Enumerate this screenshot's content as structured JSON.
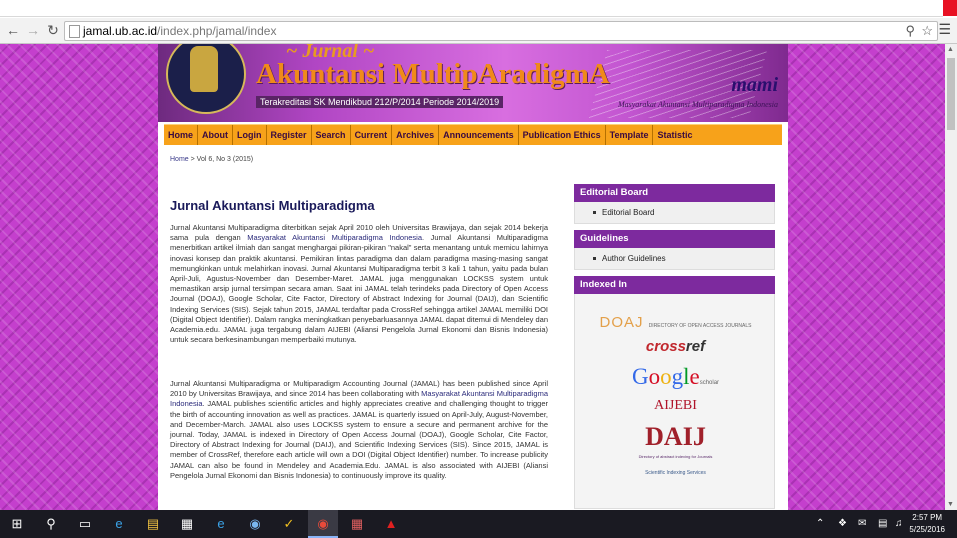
{
  "browser": {
    "back_icon": "arrow-left-icon",
    "forward_icon": "arrow-right-icon",
    "reload_icon": "reload-icon",
    "url_host": "jamal.ub.ac.id",
    "url_path": "/index.php/jamal/index"
  },
  "header": {
    "jurnal": "~ Jurnal ~",
    "title": "Akuntansi MultipAradigmA",
    "accreditation": "Terakreditasi SK Mendikbud 212/P/2014 Periode 2014/2019",
    "mami": "mami",
    "mami_sub": "Masyarakat Akuntansi Multiparadigma Indonesia"
  },
  "nav": {
    "items": [
      "Home",
      "About",
      "Login",
      "Register",
      "Search",
      "Current",
      "Archives",
      "Announcements",
      "Publication Ethics",
      "Template",
      "Statistic"
    ]
  },
  "breadcrumb": {
    "home": "Home",
    "sep": " > ",
    "current": "Vol 6, No 3 (2015)"
  },
  "main": {
    "title": "Jurnal Akuntansi Multiparadigma",
    "p1_a": "Jurnal Akuntansi Multiparadigma diterbitkan sejak April 2010 oleh Universitas Brawijaya, dan sejak 2014 bekerja sama pula dengan ",
    "p1_link": "Masyarakat Akuntansi Multiparadigma Indonesia",
    "p1_b": ". Jurnal Akuntansi Multiparadigma menerbitkan artikel ilmiah dan sangat menghargai pikiran-pikiran \"nakal\" serta menantang untuk memicu lahirnya inovasi konsep dan praktik akuntansi. Pemikiran lintas paradigma dan dalam paradigma masing-masing sangat memungkinkan untuk melahirkan inovasi. Jurnal Akuntansi Multiparadigma terbit 3 kali 1 tahun, yaitu pada bulan April-Juli, Agustus-November dan Desember-Maret. JAMAL juga menggunakan LOCKSS system untuk memastikan arsip jurnal tersimpan secara aman. Saat ini JAMAL telah terindeks pada Directory of Open Access Journal (DOAJ), Google Scholar, Cite Factor, Directory of Abstract Indexing for Journal (DAIJ), dan Scientific Indexing Services (SIS). Sejak tahun 2015, JAMAL terdaftar pada CrossRef sehingga artikel JAMAL memiliki DOI (Digital Object Identifier). Dalam rangka meningkatkan penyebarluasannya JAMAL dapat ditemui di Mendeley dan Academia.edu. JAMAL juga tergabung dalam AIJEBI (Aliansi Pengelola Jurnal Ekonomi dan Bisnis Indonesia) untuk secara berkesinambungan memperbaiki mutunya.",
    "p2_a": "Jurnal Akuntansi Multiparadigma or Multiparadigm Accounting Journal (JAMAL) has been published since April 2010 by Universitas Brawijaya, and since 2014 has been collaborating with ",
    "p2_link": "Masyarakat Akuntansi Multiparadigma Indonesia",
    "p2_b": ". JAMAL publishes scientific articles and highly appreciates creative and challenging thought to trigger the birth of accounting innovation as well as practices. JAMAL is quarterly issued on April-July, August-November, and December-March. JAMAL also uses LOCKSS system to ensure a secure and permanent archive for the journal. Today, JAMAL is indexed in Directory of Open Access Journal (DOAJ), Google Scholar, Cite Factor, Directory of Abstract Indexing for Journal (DAIJ), and Scientific Indexing Services (SIS). Since 2015, JAMAL is member of CrossRef, therefore each article will own a DOI (Digital Object Identifier) number. To increase publicity JAMAL can also be found in Mendeley and Academia.Edu. JAMAL is also associated with AIJEBI (Aliansi Pengelola Jurnal Ekonomi dan Bisnis Indonesia) to continuously improve its quality."
  },
  "sidebar": {
    "editorial_title": "Editorial Board",
    "editorial_link": "Editorial Board",
    "guidelines_title": "Guidelines",
    "guidelines_link": "Author Guidelines",
    "indexed_title": "Indexed In",
    "logos": {
      "doaj": "DOAJ",
      "doaj_sub": "DIRECTORY OF OPEN ACCESS JOURNALS",
      "crossref_a": "cross",
      "crossref_b": "ref",
      "google_scholar_sub": "scholar",
      "aijebi": "AIJEBI",
      "daij": "DAIJ",
      "daij_sub": "Directory of abstract indexing for Journals",
      "sis": "Scientific Indexing Services"
    }
  },
  "taskbar": {
    "time": "2:57 PM",
    "date": "5/25/2016"
  }
}
